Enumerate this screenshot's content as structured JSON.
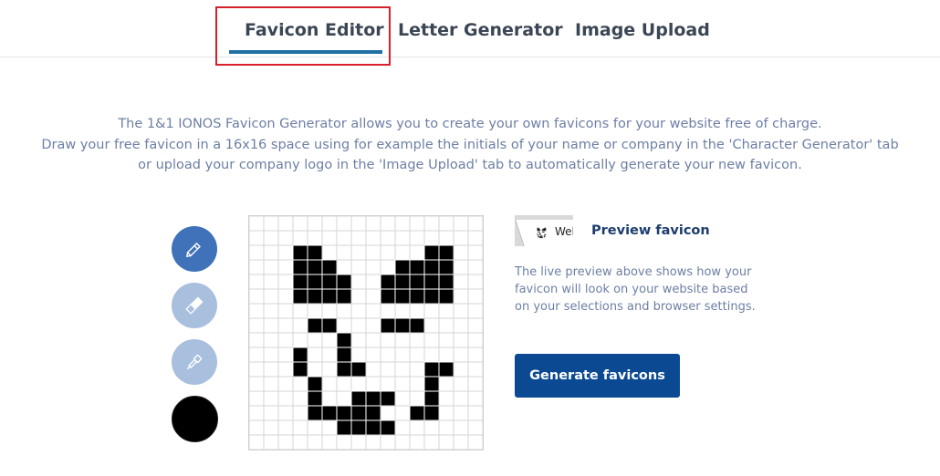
{
  "tabs": [
    {
      "label": "Favicon Editor",
      "active": true
    },
    {
      "label": "Letter Generator",
      "active": false
    },
    {
      "label": "Image Upload",
      "active": false
    }
  ],
  "intro": [
    "The 1&1 IONOS Favicon Generator allows you to create your own favicons for your website free of charge.",
    "Draw your free favicon in a 16x16 space using for example the initials of your name or company in the 'Character Generator' tab",
    "or upload your company logo in the 'Image Upload' tab to automatically generate your new favicon."
  ],
  "tools": [
    {
      "name": "pencil",
      "active": true
    },
    {
      "name": "eraser",
      "active": false
    },
    {
      "name": "color-picker",
      "active": false
    }
  ],
  "current_color": "#000000",
  "colors": {
    "accent": "#1f6fa5",
    "primary_button": "#0b4a93",
    "highlight": "#d6212c",
    "active_tool": "#3f72b8",
    "inactive_tool": "#a9bfde"
  },
  "pixel_grid": [
    "................",
    "................",
    "...##.......##..",
    "...###....####..",
    "...####..#####..",
    "...####..#####..",
    "................",
    "....##...###....",
    "......#.........",
    "...#..#.........",
    "...#..##....##..",
    "....#.......#...",
    "....#..###..#...",
    "....#####..##...",
    "......####......",
    "................"
  ],
  "preview": {
    "tab_text": "Wel",
    "label": "Preview favicon",
    "description": "The live preview above shows how your favicon will look on your website based on your selections and browser settings."
  },
  "generate_button": "Generate favicons"
}
